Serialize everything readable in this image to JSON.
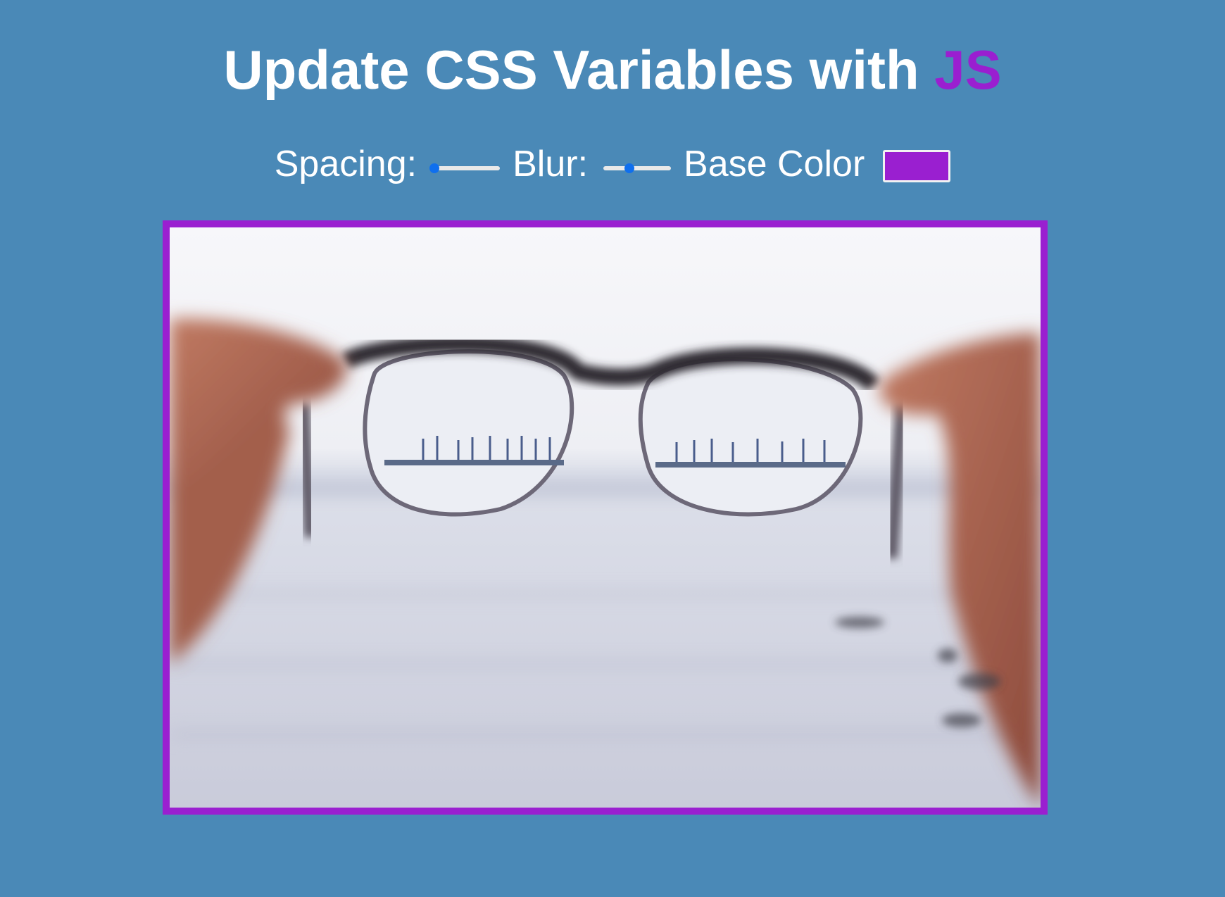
{
  "heading": {
    "prefix": "Update CSS Variables with ",
    "accent": "JS"
  },
  "controls": {
    "spacing_label": "Spacing:",
    "spacing_value": 10,
    "spacing_range": [
      10,
      200
    ],
    "blur_label": "Blur:",
    "blur_value": 10,
    "blur_range": [
      0,
      25
    ],
    "base_color_label": "Base Color",
    "base_color_value": "#9a1fd0"
  },
  "image": {
    "icon": "photo-glasses-harbor"
  },
  "colors": {
    "background": "#4a89b7",
    "accent": "#9a1fd0",
    "slider_thumb": "#0f6fee"
  }
}
